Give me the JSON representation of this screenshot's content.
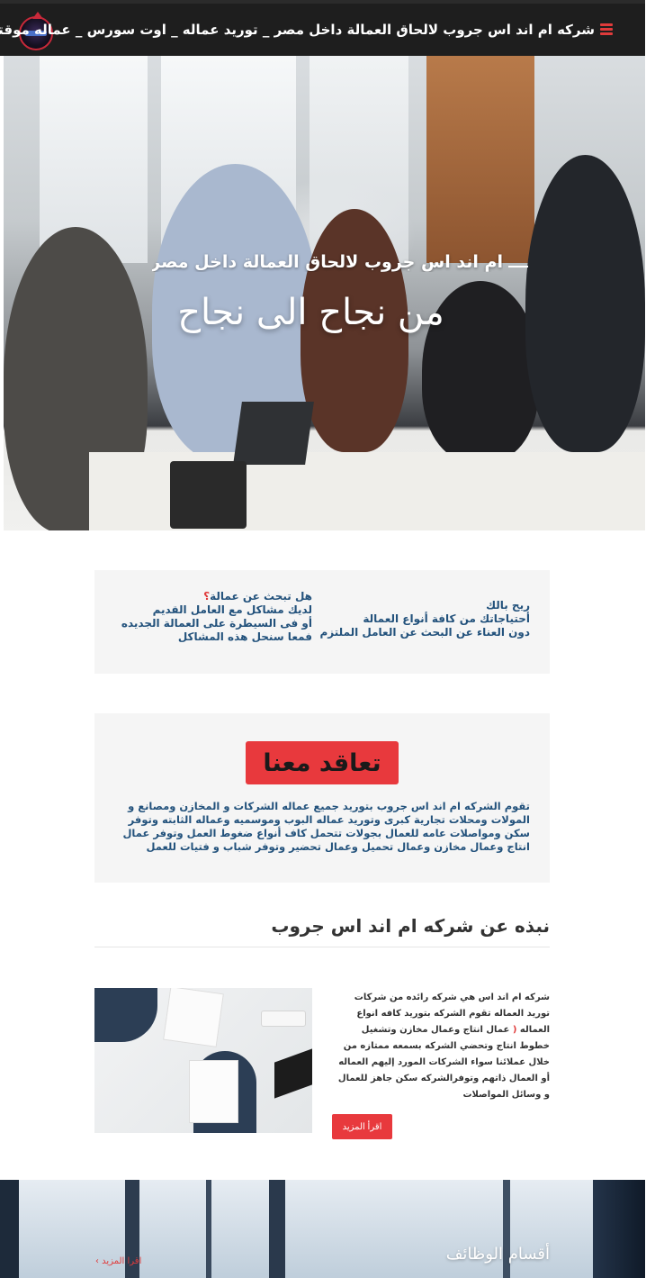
{
  "header": {
    "site_title": "شركه ام اند اس جروب لالحاق العمالة داخل مصر _ توريد عماله _ اوت سورس _ عماله موقته",
    "menu_icon": "hamburger-menu-icon",
    "logo_icon": "company-logo-icon"
  },
  "hero": {
    "subtitle": "ام اند اس جروب لالحاق العمالة داخل مصر",
    "title": "من نجاح الى نجاح"
  },
  "info_box": {
    "right_lines": [
      "ريح بالك",
      "أحتياجاتك من كافة أنواع العمالة",
      "دون العناء عن البحث عن العامل الملتزم"
    ],
    "left_question": "هل تبحث عن عمالة",
    "left_question_mark": "؟",
    "left_lines": [
      "لديك مشاكل مع العامل القديم",
      "أو فى السيطرة على العمالة الجديده",
      "فمعا سنحل هذه المشاكل"
    ]
  },
  "contract": {
    "button_label": "تعاقد معنا",
    "text": "تقوم الشركه ام اند اس جروب بتوريد جميع عماله الشركات و المخازن ومصانع و المولات ومحلات تجارية كبرى وتوريد عماله البوب وموسميه وعماله الثابته وتوفر سكن ومواصلات عامه للعمال بجولات تتحمل كاف أنواع ضغوط العمل وتوفر عمال انتاج وعمال مخازن وعمال تحميل وعمال تحضير وتوفر شباب و فتيات للعمل"
  },
  "about": {
    "title": "نبذه عن شركه ام اند اس جروب",
    "text_part1": "شركه ام اند اس هي شركه رائده من شركات توريد العماله تقوم الشركه بتوريد كافه انواع العماله",
    "text_accent": " ( ",
    "text_part2": "عمال انتاج وعمال مخازن وتشغيل خطوط انتاج وتحضي الشركه بسمعه ممتازه من خلال عملائنا سواء الشركات المورد إليهم العماله أو العمال ذاتهم وتوفرالشركه سكن جاهز للعمال و وسائل المواصلات",
    "read_more": "اقرأ المزيد"
  },
  "jobs": {
    "title": "أقسام الوظائف",
    "link": "اقرا المزيد ›"
  },
  "colors": {
    "header_bg": "#1e1e1e",
    "accent_red": "#e8393d",
    "text_blue": "#23527c",
    "box_bg": "#f5f5f5"
  }
}
